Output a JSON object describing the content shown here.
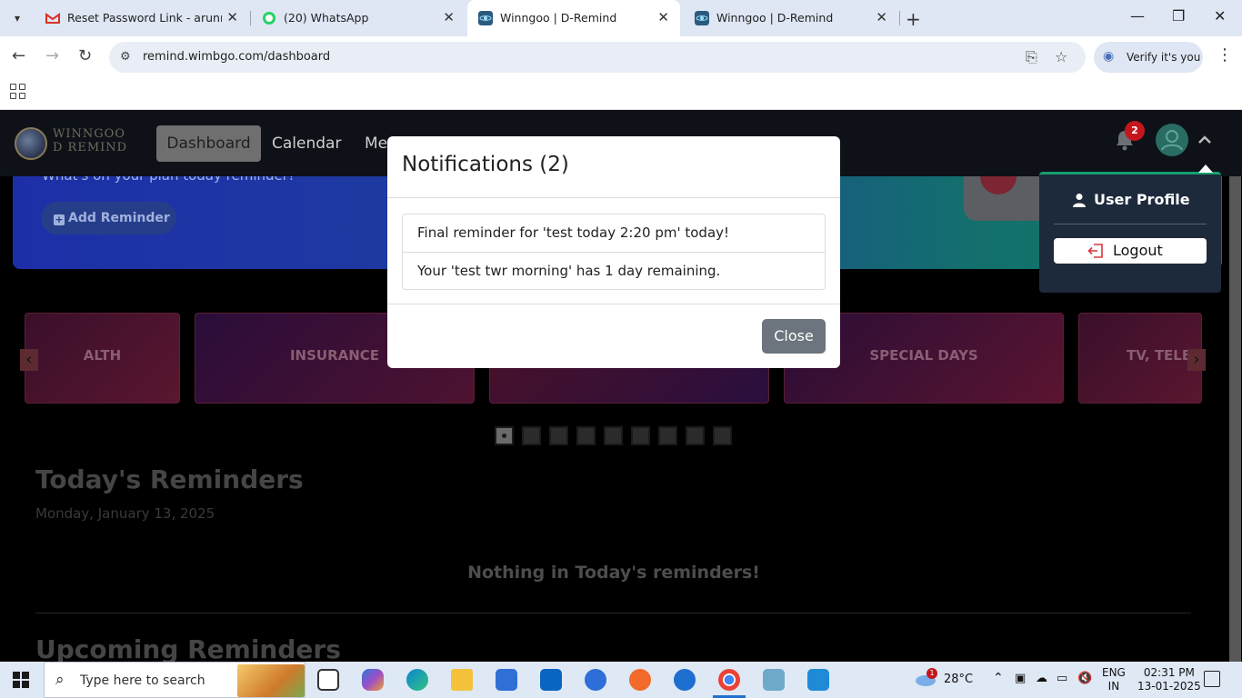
{
  "browser": {
    "tabs": [
      {
        "title": "Reset Password Link - arunraj0",
        "favicon": "gmail-icon",
        "color": "#d93025"
      },
      {
        "title": "(20) WhatsApp",
        "favicon": "whatsapp-icon",
        "color": "#25d366"
      },
      {
        "title": "Winngoo | D-Remind",
        "favicon": "react-icon",
        "color": "#2a5b7d",
        "active": true
      },
      {
        "title": "Winngoo | D-Remind",
        "favicon": "react-icon",
        "color": "#2a5b7d"
      }
    ],
    "url": "remind.wimbgo.com/dashboard",
    "verify_label": "Verify it's you"
  },
  "app": {
    "logo_line1": "WINNGOO",
    "logo_line2": "D REMIND",
    "nav": [
      "Dashboard",
      "Calendar",
      "Me"
    ],
    "notification_count": "2",
    "banner_text": "What's on your plan today reminder?",
    "add_reminder_label": "Add Reminder",
    "categories": [
      "ALTH",
      "INSURANCE",
      "",
      "SPECIAL DAYS",
      "TV, TELE"
    ],
    "carousel_pages": 9,
    "carousel_active": 1,
    "todays_title": "Today's Reminders",
    "todays_date": "Monday, January 13, 2025",
    "todays_empty": "Nothing in Today's reminders!",
    "upcoming_title": "Upcoming Reminders"
  },
  "modal": {
    "title": "Notifications (2)",
    "items": [
      "Final reminder for 'test today 2:20 pm' today!",
      "Your 'test twr morning' has 1 day remaining."
    ],
    "close_label": "Close"
  },
  "dropdown": {
    "profile_label": "User Profile",
    "logout_label": "Logout"
  },
  "taskbar": {
    "search_placeholder": "Type here to search",
    "weather": "28°C",
    "weather_badge": "1",
    "lang_line1": "ENG",
    "lang_line2": "IN",
    "time": "02:31 PM",
    "date": "13-01-2025"
  }
}
